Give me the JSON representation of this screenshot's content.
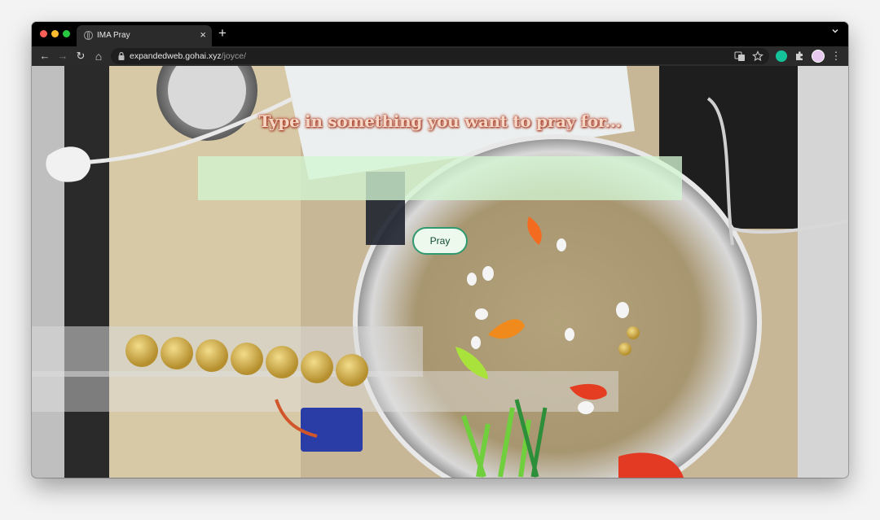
{
  "browser": {
    "tab_title": "IMA Pray",
    "tab_close": "×",
    "new_tab": "+",
    "url_host": "expandedweb.gohai.xyz",
    "url_path": "/joyce/",
    "nav": {
      "back": "←",
      "forward": "→",
      "reload": "↻",
      "home": "⌂",
      "menu": "⋮"
    },
    "icons": [
      "globe-icon",
      "lock-icon",
      "translate-icon",
      "star-icon",
      "grammarly-icon",
      "puzzle-icon",
      "avatar-icon",
      "kebab-menu-icon"
    ]
  },
  "page": {
    "heading": "Type in something you want to pray for...",
    "input_value": "",
    "button_label": "Pray"
  },
  "colors": {
    "heading_text": "#f6d7c6",
    "heading_glow": "#b3412a",
    "input_bg": "#d2f5d2",
    "button_border": "#2f9a6f"
  }
}
